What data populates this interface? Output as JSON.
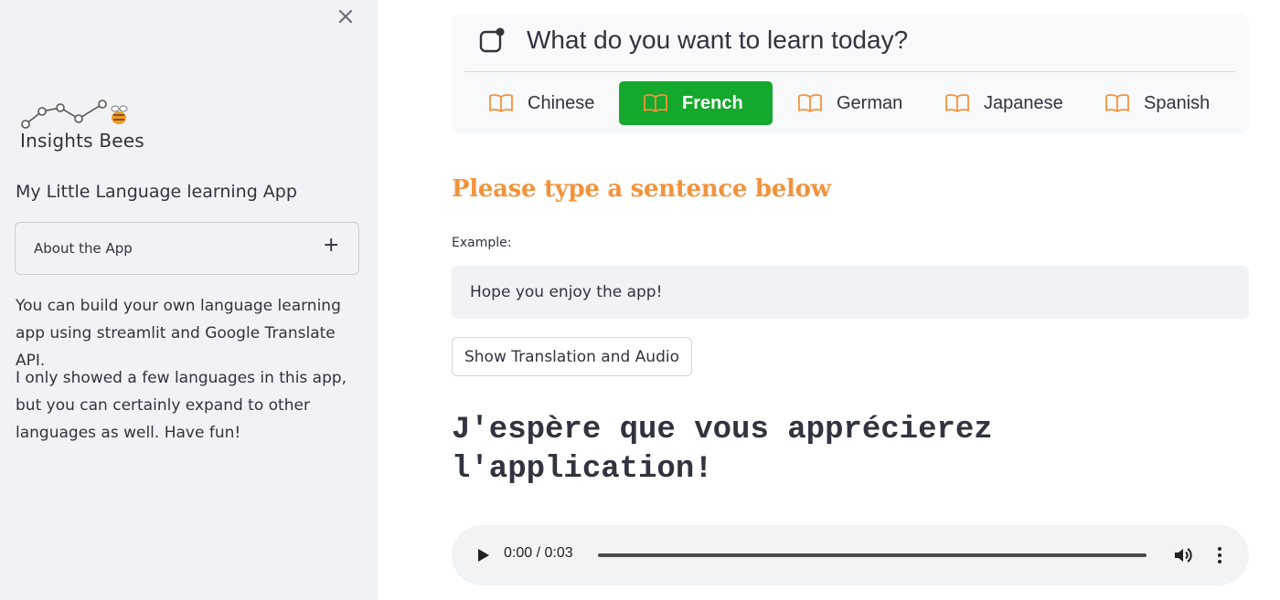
{
  "sidebar": {
    "logo_text": "Insights Bees",
    "title": "My Little Language learning App",
    "expander": {
      "label": "About the App",
      "toggle": "+"
    },
    "paragraphs": [
      "You can build your own language learning app using streamlit and Google Translate API.",
      "I only showed a few languages in this app, but you can certainly expand to other languages as well. Have fun!"
    ]
  },
  "menu": {
    "title": "What do you want to learn today?",
    "icon": "app-indicator-icon",
    "items": [
      {
        "label": "Chinese",
        "icon": "book-icon",
        "selected": false
      },
      {
        "label": "French",
        "icon": "book-icon",
        "selected": true
      },
      {
        "label": "German",
        "icon": "book-icon",
        "selected": false
      },
      {
        "label": "Japanese",
        "icon": "book-icon",
        "selected": false
      },
      {
        "label": "Spanish",
        "icon": "book-icon",
        "selected": false
      }
    ],
    "selected_color": "#14a82c",
    "icon_color": "#f2933c"
  },
  "main": {
    "heading": "Please type a sentence below",
    "heading_color": "#f2933c",
    "input_label": "Example:",
    "input_value": "Hope you enjoy the app!",
    "button_label": "Show Translation and Audio",
    "translation": "J'espère que vous apprécierez l'application!"
  },
  "audio": {
    "time": "0:00 / 0:03",
    "progress": 0
  }
}
